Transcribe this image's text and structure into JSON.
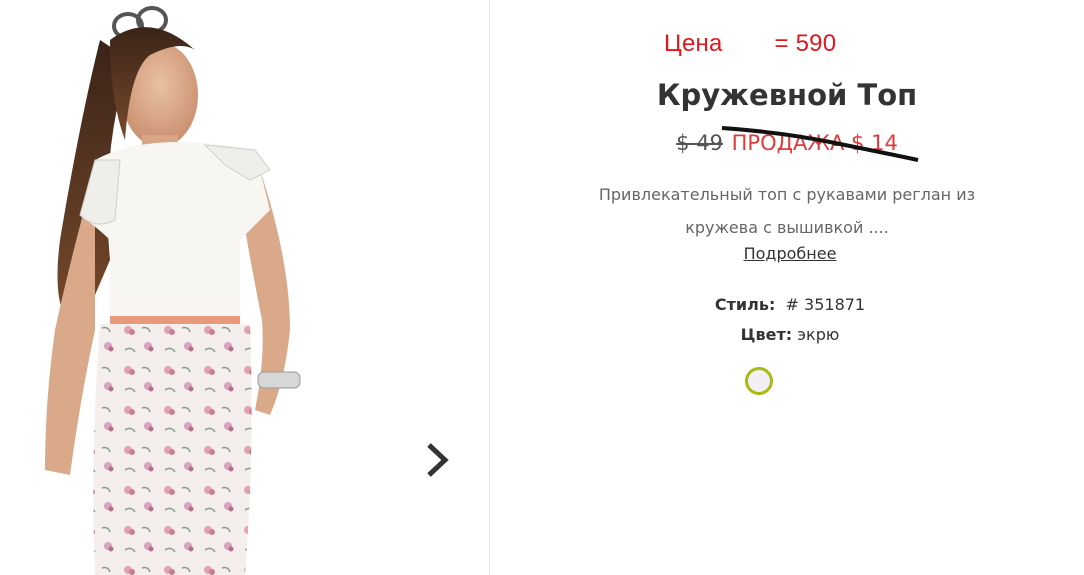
{
  "price_note": {
    "label": "Цена",
    "value": "= 590"
  },
  "product": {
    "title": "Кружевной Топ",
    "old_price": "$ 49",
    "sale_price": "ПРОДАЖА $ 14",
    "description_line1": "Привлекательный топ с рукавами реглан из",
    "description_line2": "кружева с вышивкой ....",
    "more_link": "Подробнее",
    "style_label": "Стиль:",
    "style_value": "# 351871",
    "color_label": "Цвет:",
    "color_value": "экрю",
    "swatch_color": "#f3f0f5",
    "swatch_border": "#a8bb12"
  },
  "icons": {
    "next": "chevron-right-icon"
  },
  "colors": {
    "accent_red": "#e3161c",
    "sale_red": "#e03a3a",
    "text_dark": "#333333",
    "text_muted": "#666666"
  }
}
